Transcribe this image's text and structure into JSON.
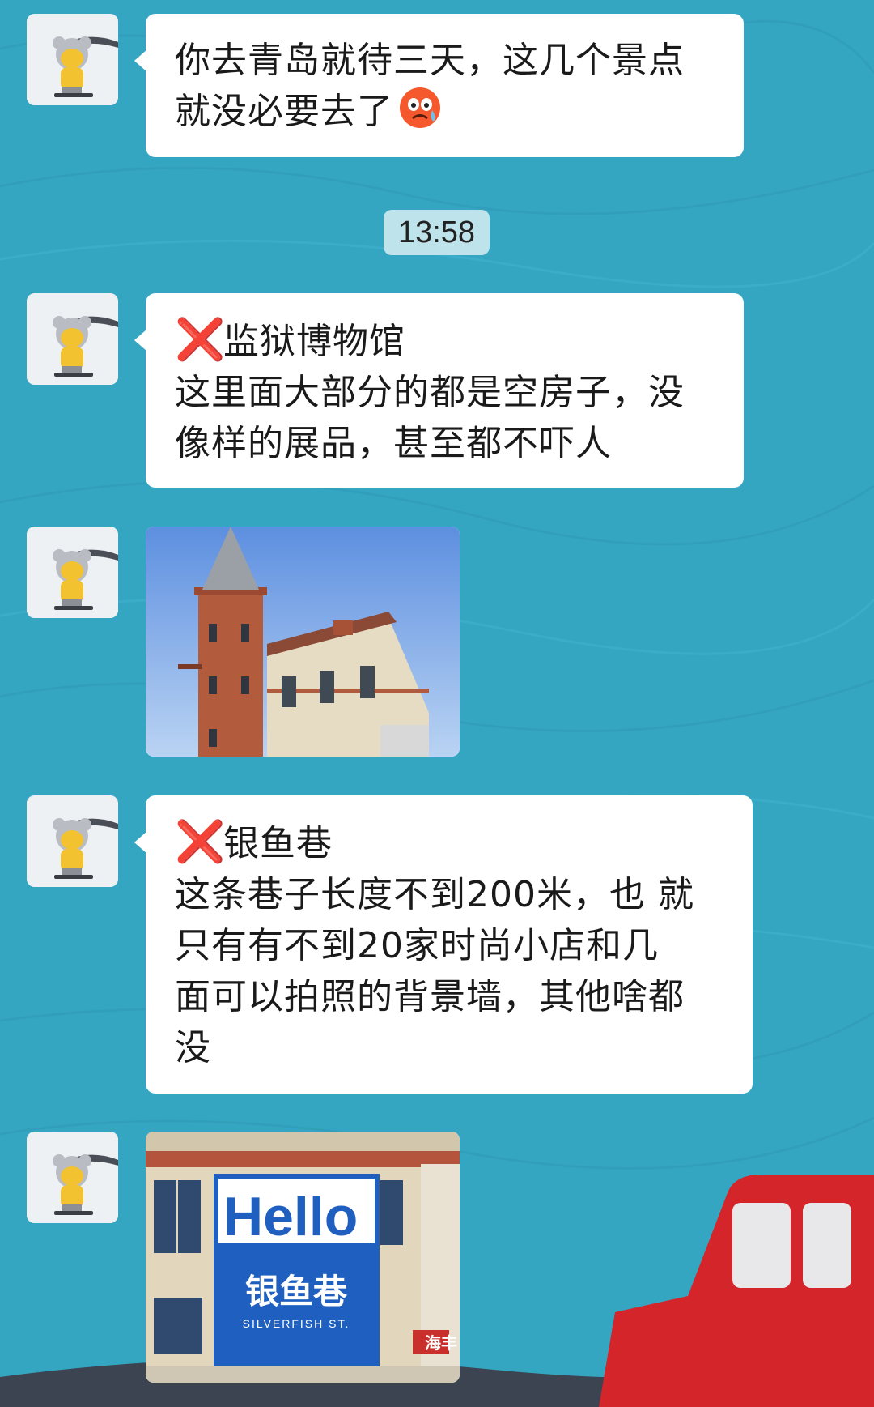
{
  "colors": {
    "background": "#35a6c2",
    "bubble": "#ffffff",
    "timestamp_bg": "#bfe3ea",
    "x_mark": "#e0231b",
    "car": "#d3252a"
  },
  "messages": [
    {
      "type": "text",
      "lines": [
        "你去青岛就待三天，这几个景点",
        "就没必要去了"
      ],
      "emoji": "crying-face-emoji"
    },
    {
      "type": "text",
      "lines": [
        "监狱博物馆",
        "这里面大部分的都是空房子，没",
        "像样的展品，甚至都不吓人"
      ],
      "title_mark": "❌"
    },
    {
      "type": "image",
      "description_icon": "prison-museum-tower-photo"
    },
    {
      "type": "text",
      "lines": [
        "银鱼巷",
        "这条巷子长度不到200米，也 就",
        "只有有不到20家时尚小店和几",
        "面可以拍照的背景墙，其他啥都",
        "没"
      ],
      "title_mark": "❌"
    },
    {
      "type": "image",
      "description_icon": "silverfish-street-sign-photo",
      "sign": {
        "hello": "Hello",
        "cn": "银鱼巷",
        "en": "SILVERFISH ST.",
        "corner": "海丰"
      }
    }
  ],
  "timestamp": "13:58"
}
